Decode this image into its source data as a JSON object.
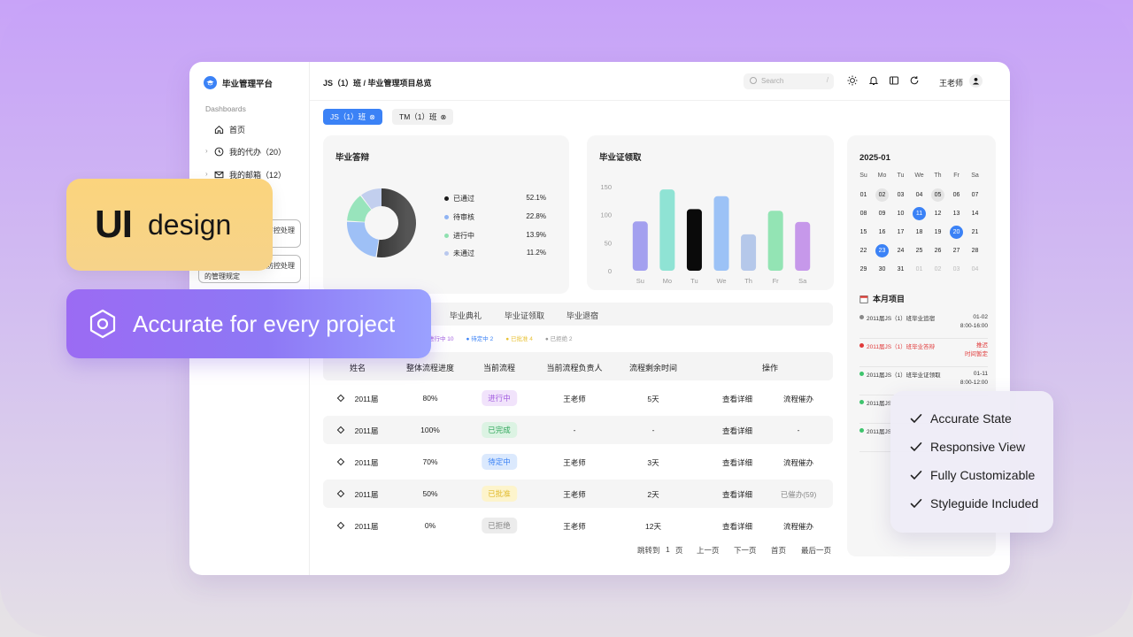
{
  "sidebar": {
    "brand": "毕业管理平台",
    "section": "Dashboards",
    "items": [
      {
        "label": "首页"
      },
      {
        "label": "我的代办（20）"
      },
      {
        "label": "我的邮箱（12）"
      }
    ],
    "box_items": [
      {
        "label": "防控处理"
      },
      {
        "label": "防控处理"
      }
    ],
    "box_footer": "的管理规定"
  },
  "header": {
    "breadcrumb": "JS（1）班 / 毕业管理项目总览",
    "search_placeholder": "Search",
    "search_shortcut": "/",
    "user": "王老师"
  },
  "class_tabs": [
    {
      "label": "JS（1）班",
      "active": true
    },
    {
      "label": "TM（1）班",
      "active": false
    }
  ],
  "defense": {
    "title": "毕业答辩",
    "legend": [
      {
        "label": "已通过",
        "value": "52.1%",
        "color": "#1a1a1a"
      },
      {
        "label": "待审核",
        "value": "22.8%",
        "color": "#8fb3f3"
      },
      {
        "label": "进行中",
        "value": "13.9%",
        "color": "#8fe0b0"
      },
      {
        "label": "未通过",
        "value": "11.2%",
        "color": "#b9c8ee"
      }
    ]
  },
  "certificate": {
    "title": "毕业证领取"
  },
  "chart_data": {
    "type": "bar",
    "title": "毕业证领取",
    "categories": [
      "Su",
      "Mo",
      "Tu",
      "We",
      "Th",
      "Fr",
      "Sa"
    ],
    "values": [
      88,
      145,
      110,
      133,
      65,
      107,
      87
    ],
    "colors": [
      "#a3a0ef",
      "#8fe3d4",
      "#0a0a0a",
      "#9cc2f6",
      "#b5c8ea",
      "#93e4b4",
      "#c698ea"
    ],
    "yticks": [
      "150",
      "100",
      "50",
      "0"
    ],
    "ylim": [
      0,
      150
    ]
  },
  "calendar": {
    "month": "2025-01",
    "weekdays": [
      "Su",
      "Mo",
      "Tu",
      "We",
      "Th",
      "Fr",
      "Sa"
    ],
    "days": [
      "01",
      "02",
      "03",
      "04",
      "05",
      "06",
      "07",
      "08",
      "09",
      "10",
      "11",
      "12",
      "13",
      "14",
      "15",
      "16",
      "17",
      "18",
      "19",
      "20",
      "21",
      "22",
      "23",
      "24",
      "25",
      "26",
      "27",
      "28",
      "29",
      "30",
      "31",
      "01",
      "02",
      "03",
      "04"
    ],
    "project_title": "本月项目",
    "projects": [
      {
        "name": "2011届JS（1）班毕业追宿",
        "time1": "01-02",
        "time2": "8:00-16:00",
        "color": "#888",
        "text_color": "#333"
      },
      {
        "name": "2011届JS（1）班毕业答辩",
        "time1": "推迟",
        "time2": "时间暂定",
        "color": "#e03a3a",
        "text_color": "#e03a3a"
      },
      {
        "name": "2011届JS（1）班毕业证领取",
        "time1": "01-11",
        "time2": "8:00-12:00",
        "color": "#3ec46d",
        "text_color": "#333"
      },
      {
        "name": "2011届JS",
        "time1": "",
        "time2": "",
        "color": "#3ec46d",
        "text_color": "#333"
      },
      {
        "name": "2011届JS",
        "time1": "",
        "time2": "",
        "color": "#3ec46d",
        "text_color": "#333"
      }
    ]
  },
  "process_tabs": [
    "毕业典礼",
    "毕业证领取",
    "毕业退宿"
  ],
  "status_filters": [
    {
      "label": "进行中 10",
      "color": "#a35ee0"
    },
    {
      "label": "待定中 2",
      "color": "#3b82f6"
    },
    {
      "label": "已批准 4",
      "color": "#e8c235"
    },
    {
      "label": "已拒绝 2",
      "color": "#999"
    }
  ],
  "table": {
    "headers": [
      "姓名",
      "整体流程进度",
      "当前流程",
      "当前流程负责人",
      "流程剩余时间",
      "操作"
    ],
    "rows": [
      {
        "name": "2011届",
        "progress": "80%",
        "status": "进行中",
        "owner": "王老师",
        "remaining": "5天",
        "view": "查看详细",
        "urge": "流程催办"
      },
      {
        "name": "2011届",
        "progress": "100%",
        "status": "已完成",
        "owner": "-",
        "remaining": "-",
        "view": "查看详细",
        "urge": "-"
      },
      {
        "name": "2011届",
        "progress": "70%",
        "status": "待定中",
        "owner": "王老师",
        "remaining": "3天",
        "view": "查看详细",
        "urge": "流程催办"
      },
      {
        "name": "2011届",
        "progress": "50%",
        "status": "已批准",
        "owner": "王老师",
        "remaining": "2天",
        "view": "查看详细",
        "urge": "已催办(59)"
      },
      {
        "name": "2011届",
        "progress": "0%",
        "status": "已拒绝",
        "owner": "王老师",
        "remaining": "12天",
        "view": "查看详细",
        "urge": "流程催办"
      }
    ]
  },
  "pager": [
    "跳转到",
    "1",
    "页",
    "上一页",
    "下一页",
    "首页",
    "最后一页"
  ],
  "overlay": {
    "ui_big": "UI",
    "ui_small": "design",
    "accurate": "Accurate for every project",
    "checklist": [
      "Accurate State",
      "Responsive View",
      "Fully Customizable",
      "Styleguide Included"
    ]
  }
}
